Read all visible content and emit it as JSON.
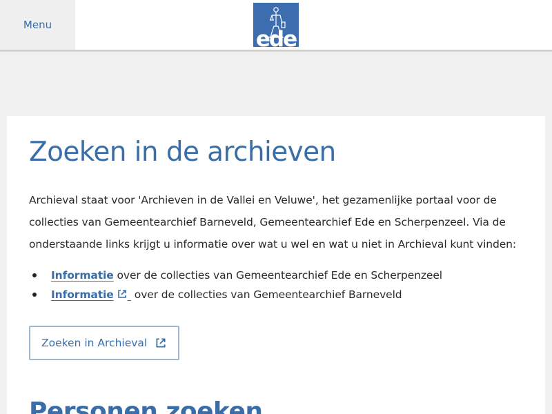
{
  "header": {
    "menu_label": "Menu",
    "logo_text": "ede",
    "brand_color": "#3c6eaf"
  },
  "main": {
    "title": "Zoeken in de archieven",
    "intro": "Archieval staat voor 'Archieven in de Vallei en Veluwe', het gezamenlijke portaal voor de collecties van Gemeentearchief Barneveld, Gemeentearchief Ede en Scherpenzeel. Via de onderstaande links krijgt u informatie over wat u wel en wat u niet in Archieval kunt vinden:",
    "links": [
      {
        "link_text": "Informatie",
        "rest": " over de collecties van Gemeentearchief Ede en Scherpenzeel",
        "external": false
      },
      {
        "link_text": "Informatie",
        "rest": " over de collecties van Gemeentearchief Barneveld",
        "external": true
      }
    ],
    "search_button_label": "Zoeken in Archieval",
    "next_section_title": "Personen zoeken"
  },
  "icons": {
    "external_link": "external-link-icon",
    "logo_figure": "justitia-figure-icon"
  }
}
